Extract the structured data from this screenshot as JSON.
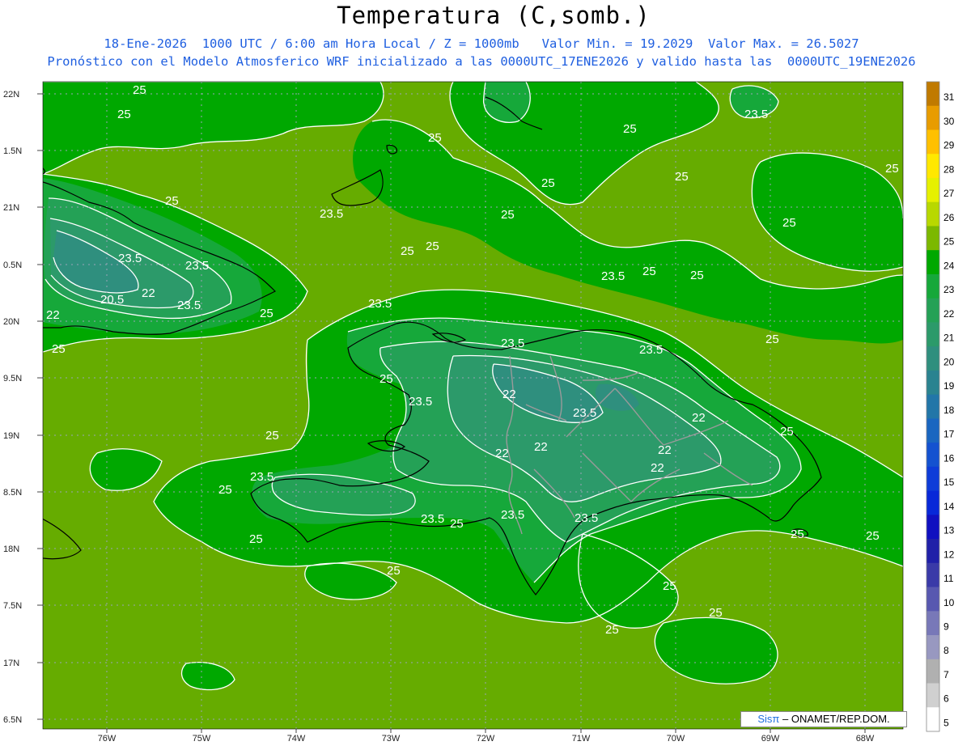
{
  "header": {
    "title": "Temperatura (C,somb.)",
    "subtitle_1": "18-Ene-2026  1000 UTC / 6:00 am Hora Local / Z = 1000mb   Valor Min. = 19.2029  Valor Max. = 26.5027",
    "subtitle_2": "Pronóstico con el Modelo Atmosferico WRF inicializado a las 0000UTC_17ENE2026 y valido hasta las  0000UTC_19ENE2026"
  },
  "map": {
    "lat_labels": [
      "22N",
      "1.5N",
      "21N",
      "0.5N",
      "20N",
      "9.5N",
      "19N",
      "8.5N",
      "18N",
      "7.5N",
      "17N",
      "6.5N"
    ],
    "lon_labels": [
      "76W",
      "75W",
      "74W",
      "73W",
      "72W",
      "71W",
      "70W",
      "69W",
      "68W"
    ],
    "contour_labels": [
      "25",
      "25",
      "25",
      "23.5",
      "25",
      "25",
      "25",
      "25",
      "25",
      "23.5",
      "25",
      "25",
      "25",
      "25",
      "23.5",
      "23.5",
      "22",
      "20.5",
      "22",
      "23.5",
      "22",
      "25",
      "25",
      "23.5",
      "23.5",
      "25",
      "23.5",
      "22",
      "23.5",
      "23.5",
      "22",
      "22",
      "22",
      "22",
      "25",
      "23.5",
      "23.5",
      "25",
      "25",
      "23.5",
      "23.5",
      "25",
      "25",
      "25",
      "25",
      "23.5",
      "25",
      "25",
      "25",
      "25",
      "25",
      "25",
      "25"
    ],
    "colors": {
      "c24": "#00a800",
      "c25": "#66ac00",
      "c23": "#16a83a",
      "c22": "#24a156",
      "c21": "#2c9a6a",
      "c20": "#2f8f7e",
      "grid": "#9aa4b8",
      "coast": "#000000",
      "border": "#9a9a9a",
      "contour": "#ffffff"
    }
  },
  "colorbar": {
    "values": [
      "31",
      "30",
      "29",
      "28",
      "27",
      "26",
      "25",
      "24",
      "23",
      "22",
      "21",
      "20",
      "19",
      "18",
      "17",
      "16",
      "15",
      "14",
      "13",
      "12",
      "11",
      "10",
      "9",
      "8",
      "7",
      "6",
      "5"
    ],
    "colors": [
      "#c07a00",
      "#e89c00",
      "#ffc000",
      "#ffe800",
      "#e6f000",
      "#b8d800",
      "#7cb800",
      "#00a800",
      "#16a83a",
      "#24a156",
      "#2c9a6a",
      "#2f8f7e",
      "#2a8390",
      "#2276a8",
      "#1a66c0",
      "#1452d0",
      "#0e3cd8",
      "#0828d8",
      "#1010c0",
      "#2020a8",
      "#3a3aa8",
      "#5858b0",
      "#7878b8",
      "#9898c0",
      "#b0b0b0",
      "#d0d0d0",
      "#ffffff"
    ]
  },
  "credit": {
    "sis": "Sisπ",
    "rest": "– ONAMET/REP.DOM."
  }
}
